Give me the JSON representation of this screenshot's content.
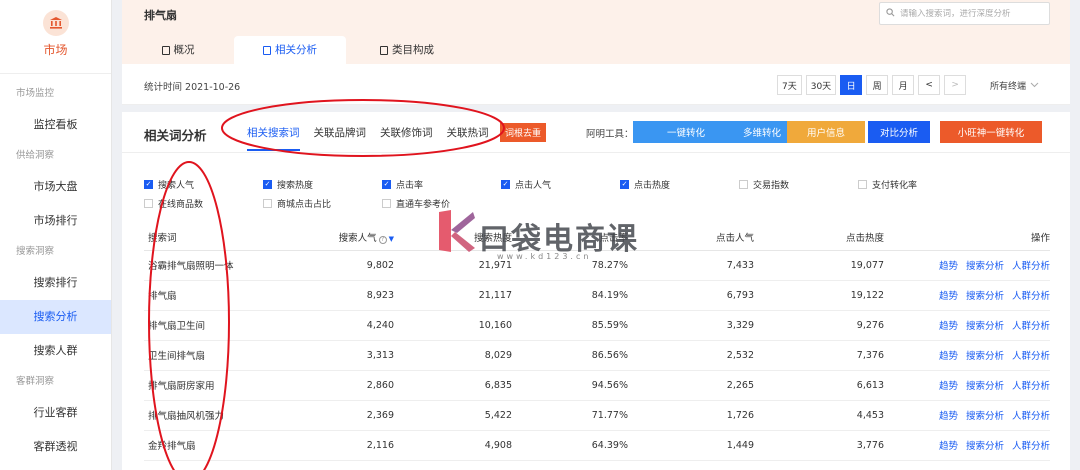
{
  "sidebar": {
    "brand_label": "市场",
    "groups": [
      {
        "title": "市场监控",
        "items": [
          "监控看板"
        ]
      },
      {
        "title": "供给洞察",
        "items": [
          "市场大盘",
          "市场排行"
        ]
      },
      {
        "title": "搜索洞察",
        "items": [
          "搜索排行",
          "搜索分析",
          "搜索人群"
        ]
      },
      {
        "title": "客群洞察",
        "items": [
          "行业客群",
          "客群透视"
        ]
      }
    ],
    "active_item": "搜索分析"
  },
  "header": {
    "title": "排气扇",
    "search_placeholder": "请输入搜索词，进行深度分析",
    "tabs": [
      "概况",
      "相关分析",
      "类目构成"
    ]
  },
  "statsbar": {
    "time_label": "统计时间 2021-10-26",
    "periods": [
      "7天",
      "30天",
      "日",
      "周",
      "月"
    ],
    "active_period": "日",
    "prev": "<",
    "next": ">",
    "terminal": "所有终端"
  },
  "panel": {
    "title": "相关词分析",
    "subtabs": [
      "相关搜索词",
      "关联品牌词",
      "关联修饰词",
      "关联热词"
    ],
    "dedup_label": "词根去重",
    "tools_label": "阿明工具：",
    "tool_buttons": [
      {
        "label": "一键转化",
        "color": "#3a96f2"
      },
      {
        "label": "多维转化",
        "color": "#3a96f2"
      },
      {
        "label": "用户信息",
        "color": "#f0a93b"
      },
      {
        "label": "对比分析",
        "color": "#1a5cf2"
      },
      {
        "label": "小旺神一键转化",
        "color": "#ec5a2a"
      }
    ]
  },
  "checkboxes": [
    {
      "label": "搜索人气",
      "checked": true
    },
    {
      "label": "搜索热度",
      "checked": true
    },
    {
      "label": "点击率",
      "checked": true
    },
    {
      "label": "点击人气",
      "checked": true
    },
    {
      "label": "点击热度",
      "checked": true
    },
    {
      "label": "交易指数",
      "checked": false
    },
    {
      "label": "支付转化率",
      "checked": false
    },
    {
      "label": "在线商品数",
      "checked": false
    },
    {
      "label": "商城点击占比",
      "checked": false
    },
    {
      "label": "直通车参考价",
      "checked": false
    }
  ],
  "table": {
    "headers": [
      "搜索词",
      "搜索人气",
      "搜索热度",
      "点击率",
      "点击人气",
      "点击热度",
      "操作"
    ],
    "ops": [
      "趋势",
      "搜索分析",
      "人群分析"
    ],
    "rows": [
      [
        "浴霸排气扇照明一体",
        "9,802",
        "21,971",
        "78.27%",
        "7,433",
        "19,077"
      ],
      [
        "排气扇",
        "8,923",
        "21,117",
        "84.19%",
        "6,793",
        "19,122"
      ],
      [
        "排气扇卫生间",
        "4,240",
        "10,160",
        "85.59%",
        "3,329",
        "9,276"
      ],
      [
        "卫生间排气扇",
        "3,313",
        "8,029",
        "86.56%",
        "2,532",
        "7,376"
      ],
      [
        "排气扇厨房家用",
        "2,860",
        "6,835",
        "94.56%",
        "2,265",
        "6,613"
      ],
      [
        "排气扇抽风机强力",
        "2,369",
        "5,422",
        "71.77%",
        "1,726",
        "4,453"
      ],
      [
        "金羚排气扇",
        "2,116",
        "4,908",
        "64.39%",
        "1,449",
        "3,776"
      ]
    ]
  },
  "watermark": {
    "text": "口袋电商课",
    "sub": "www.kd123.cn"
  },
  "colors": {
    "accent": "#1a5cf2",
    "annotation": "#e0141e",
    "orange": "#ec5a2a"
  }
}
